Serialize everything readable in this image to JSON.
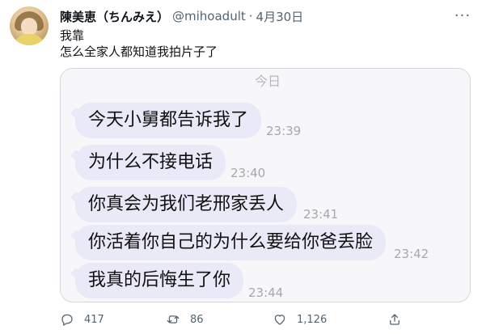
{
  "tweet": {
    "author_name": "陳美恵（ちんみえ）",
    "handle": "@mihoadult",
    "separator": "·",
    "date": "4月30日",
    "more": "···",
    "text_lines": [
      "我靠",
      "怎么全家人都知道我拍片子了"
    ],
    "avatar_icon": "avatar-photo"
  },
  "image": {
    "day_label": "今日",
    "bubble_color": "#e9e9f7",
    "messages": [
      {
        "text": "今天小舅都告诉我了",
        "time": "23:39"
      },
      {
        "text": "为什么不接电话",
        "time": "23:40"
      },
      {
        "text": "你真会为我们老邢家丢人",
        "time": "23:41"
      },
      {
        "text": "你活着你自己的为什么要给你爸丢脸",
        "time": "23:42"
      },
      {
        "text": "我真的后悔生了你",
        "time": "23:44"
      }
    ]
  },
  "actions": {
    "reply": {
      "icon": "reply-icon",
      "count": "417"
    },
    "retweet": {
      "icon": "retweet-icon",
      "count": "86"
    },
    "like": {
      "icon": "heart-icon",
      "count": "1,126"
    },
    "share": {
      "icon": "share-icon"
    }
  }
}
